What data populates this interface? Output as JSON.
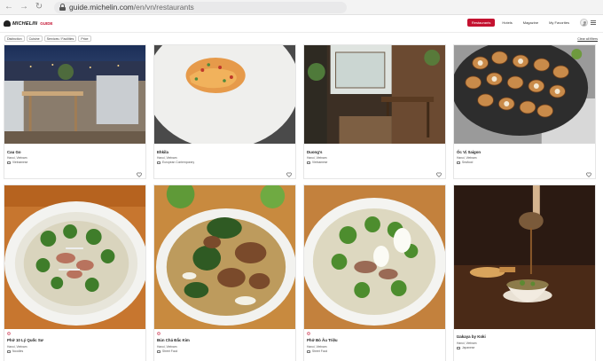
{
  "browser": {
    "url_host": "guide.michelin.com",
    "url_path": "/en/vn/restaurants"
  },
  "header": {
    "logo_text": "MICHELIN",
    "logo_sub": "GUIDE",
    "nav": {
      "restaurants": "Restaurants",
      "hotels": "Hotels",
      "magazine": "Magazine",
      "favorites": "My Favorites"
    }
  },
  "filters": {
    "chips": [
      "Distinction",
      "Cuisine",
      "Services / Facilities",
      "Price"
    ],
    "clear": "Clear all filters"
  },
  "restaurants": [
    {
      "name": "Cau Go",
      "location": "Hanoi, Vietnam",
      "cuisine": "Vietnamese",
      "award": ""
    },
    {
      "name": "Ehkila",
      "location": "Hanoi, Vietnam",
      "cuisine": "European Contemporary",
      "award": ""
    },
    {
      "name": "Duong's",
      "location": "Hanoi, Vietnam",
      "cuisine": "Vietnamese",
      "award": ""
    },
    {
      "name": "Ốc Vị Saigon",
      "location": "Hanoi, Vietnam",
      "cuisine": "Seafood",
      "award": ""
    },
    {
      "name": "Phở 10 Lý Quốc Sư",
      "location": "Hanoi, Vietnam",
      "cuisine": "Noodles",
      "award": "fork"
    },
    {
      "name": "Bún Chả Đắc Kim",
      "location": "Hanoi, Vietnam",
      "cuisine": "Street Food",
      "award": "fork"
    },
    {
      "name": "Phở Bò Âu Triệu",
      "location": "Hanoi, Vietnam",
      "cuisine": "Street Food",
      "award": "fork"
    },
    {
      "name": "Izakaya by Koki",
      "location": "Hanoi, Vietnam",
      "cuisine": "Japanese",
      "award": ""
    }
  ],
  "colors": {
    "brand_red": "#c41230"
  }
}
